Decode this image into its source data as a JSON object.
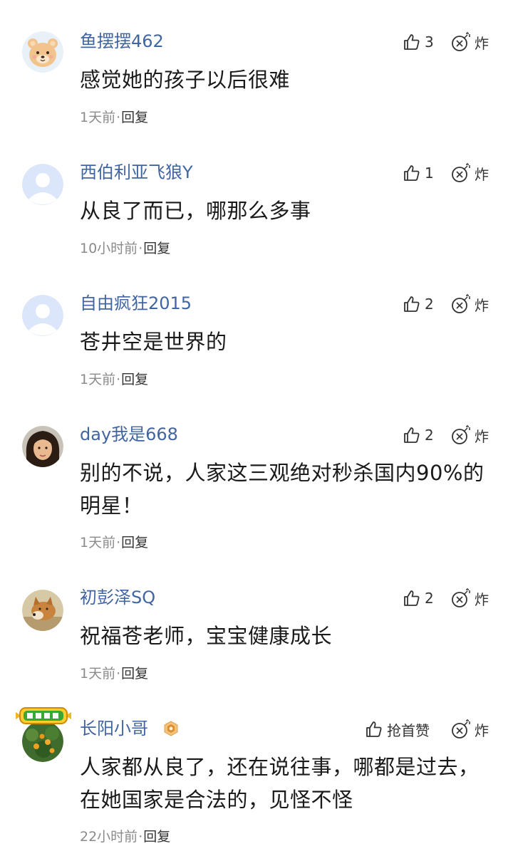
{
  "comments": [
    {
      "avatar": "cartoon-bear-avatar",
      "username": "鱼摆摆462",
      "text": "感觉她的孩子以后很难",
      "time": "1天前",
      "reply": "回复",
      "likes": "3",
      "bomb": "炸"
    },
    {
      "avatar": "default-avatar",
      "username": "西伯利亚飞狼Y",
      "text": "从良了而已，哪那么多事",
      "time": "10小时前",
      "reply": "回复",
      "likes": "1",
      "bomb": "炸"
    },
    {
      "avatar": "default-avatar",
      "username": "自由疯狂2015",
      "text": "苍井空是世界的",
      "time": "1天前",
      "reply": "回复",
      "likes": "2",
      "bomb": "炸"
    },
    {
      "avatar": "girl-photo-avatar",
      "username": "day我是668",
      "text": "别的不说，人家这三观绝对秒杀国内90%的明星！",
      "time": "1天前",
      "reply": "回复",
      "likes": "2",
      "bomb": "炸"
    },
    {
      "avatar": "dog-photo-avatar",
      "username": "初彭泽SQ",
      "text": "祝福苍老师，宝宝健康成长",
      "time": "1天前",
      "reply": "回复",
      "likes": "2",
      "bomb": "炸"
    },
    {
      "avatar": "fruit-tree-avatar",
      "username": "长阳小哥",
      "badge": "hexagon-badge-icon",
      "medal": "评论达人-medal",
      "text": "人家都从良了，还在说往事，哪都是过去，在她国家是合法的，见怪不怪",
      "time": "22小时前",
      "reply": "回复",
      "likes": "抢首赞",
      "bomb": "炸"
    }
  ],
  "separator": "·",
  "colors": {
    "username": "#4065a2",
    "text": "#1a1a1a",
    "meta": "#8a8a8a",
    "icon": "#333333"
  }
}
